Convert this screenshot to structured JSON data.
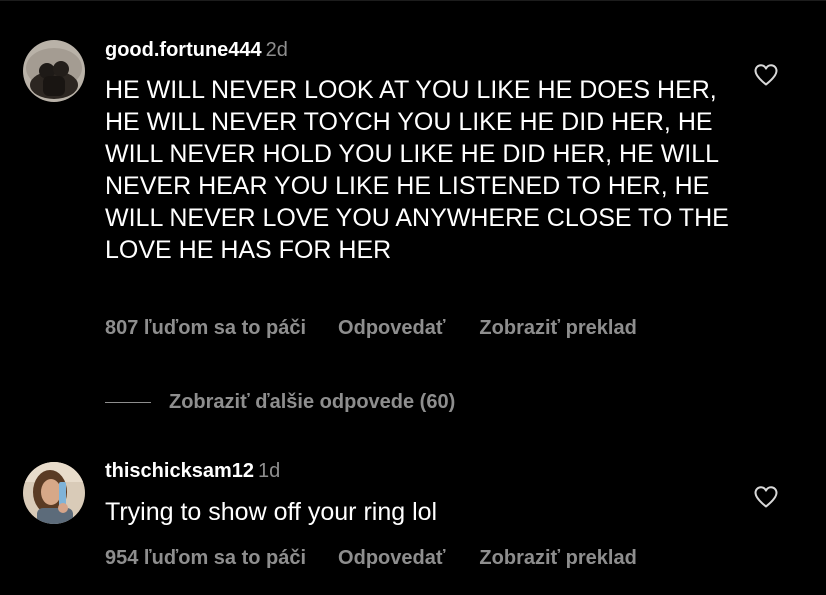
{
  "comments": [
    {
      "username": "good.fortune444",
      "time": "2d",
      "text": "HE WILL NEVER LOOK AT YOU LIKE HE DOES HER, HE WILL NEVER TOYCH YOU LIKE HE DID HER, HE WILL NEVER HOLD YOU LIKE HE DID HER, HE WILL NEVER HEAR YOU LIKE HE LISTENED TO HER, HE WILL NEVER LOVE YOU ANYWHERE CLOSE TO THE LOVE HE HAS FOR HER",
      "likes": "807 ľuďom sa to páči",
      "reply_label": "Odpovedať",
      "translate_label": "Zobraziť preklad",
      "avatar_icon": "profile-photo",
      "like_icon": "heart-outline-icon"
    },
    {
      "username": "thischicksam12",
      "time": "1d",
      "text": "Trying to show off your ring lol",
      "likes": "954 ľuďom sa to páči",
      "reply_label": "Odpovedať",
      "translate_label": "Zobraziť preklad",
      "avatar_icon": "profile-photo",
      "like_icon": "heart-outline-icon"
    }
  ],
  "more_replies": {
    "label": "Zobraziť ďalšie odpovede (60)"
  },
  "colors": {
    "background": "#000000",
    "primary_text": "#ffffff",
    "secondary_text": "#8e8e8e"
  }
}
